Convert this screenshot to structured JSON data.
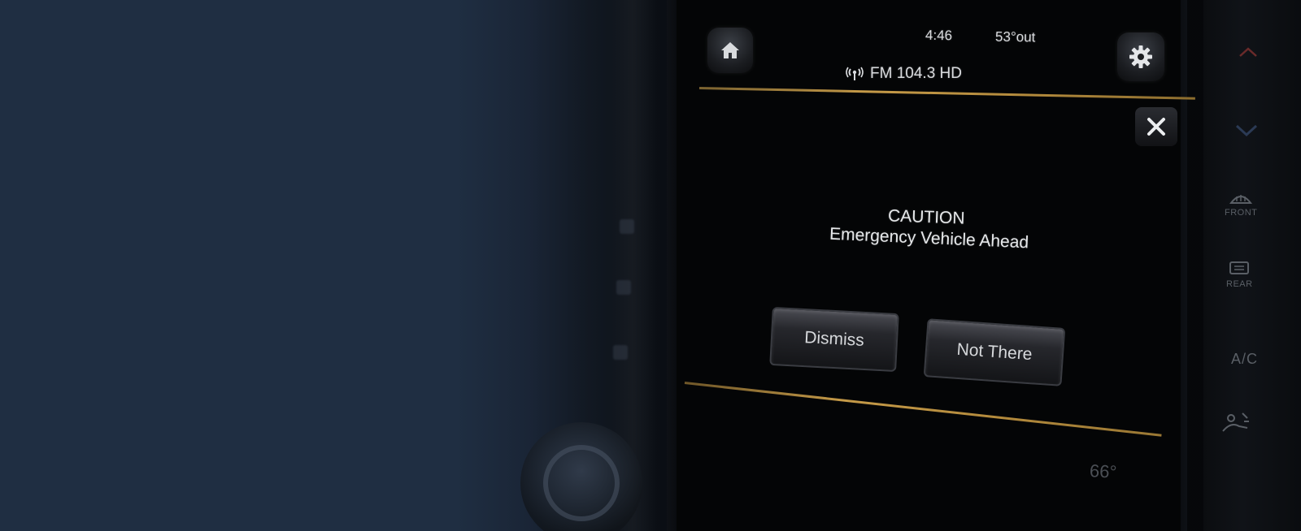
{
  "status_bar": {
    "time": "4:46",
    "outside_temp": "53°out",
    "radio_source": "FM 104.3 HD"
  },
  "alert": {
    "title": "CAUTION",
    "message": "Emergency Vehicle Ahead",
    "buttons": {
      "dismiss": "Dismiss",
      "not_there": "Not There"
    }
  },
  "climate": {
    "inside_temp": "66°",
    "front_defrost_label": "FRONT",
    "rear_defrost_label": "REAR",
    "ac_label": "A/C"
  },
  "icons": [
    "home-icon",
    "gear-icon",
    "radio-signal-icon",
    "close-icon",
    "chevron-up-icon",
    "chevron-down-icon",
    "front-defrost-icon",
    "rear-defrost-icon",
    "fan-icon"
  ],
  "colors": {
    "accent_gold": "#c59a48",
    "background_navy": "#1f2e42",
    "screen_black": "#040506"
  }
}
